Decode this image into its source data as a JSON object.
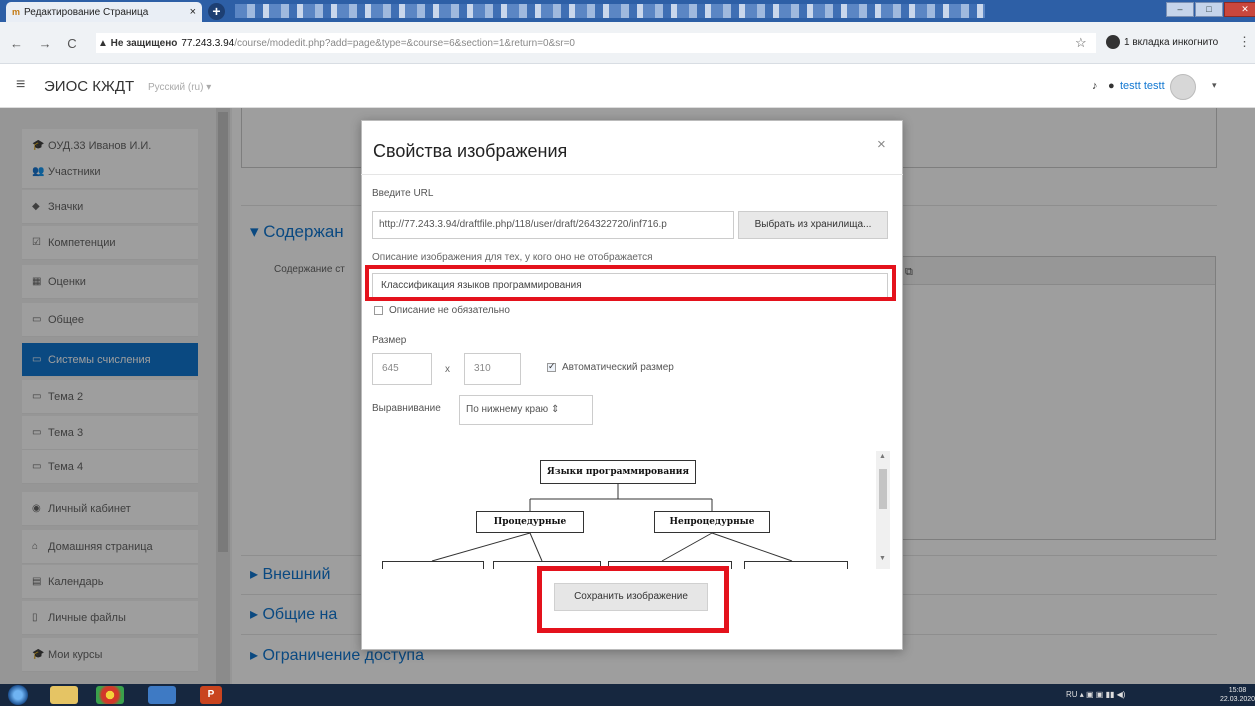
{
  "browser": {
    "tab_title": "Редактирование Страница",
    "tab_favicon": "moodle-icon",
    "nav_buttons": "← → C",
    "security_warning": "▲ Не защищено",
    "url_host": "77.243.3.94",
    "url_path": "/course/modedit.php?add=page&type=&course=6&section=1&return=0&sr=0",
    "incognito_label": "1 вкладка инкогнито"
  },
  "header": {
    "site_name": "ЭИОС КЖДТ",
    "language": "Русский (ru) ▾",
    "user_name": "testt testt"
  },
  "sidebar": {
    "items": [
      {
        "icon": "graduation-cap-icon",
        "glyph": "🎓",
        "label": "ОУД.33 Иванов И.И."
      },
      {
        "icon": "users-icon",
        "glyph": "👥",
        "label": "Участники"
      },
      {
        "icon": "shield-icon",
        "glyph": "◆",
        "label": "Значки"
      },
      {
        "icon": "checkbox-icon",
        "glyph": "☑",
        "label": "Компетенции"
      },
      {
        "icon": "table-icon",
        "glyph": "▦",
        "label": "Оценки"
      },
      {
        "icon": "folder-icon",
        "glyph": "▭",
        "label": "Общее"
      },
      {
        "icon": "folder-icon",
        "glyph": "▭",
        "label": "Системы счисления",
        "active": true
      },
      {
        "icon": "folder-icon",
        "glyph": "▭",
        "label": "Тема 2"
      },
      {
        "icon": "folder-icon",
        "glyph": "▭",
        "label": "Тема 3"
      },
      {
        "icon": "folder-icon",
        "glyph": "▭",
        "label": "Тема 4"
      },
      {
        "icon": "dashboard-icon",
        "glyph": "◉",
        "label": "Личный кабинет"
      },
      {
        "icon": "home-icon",
        "glyph": "⌂",
        "label": "Домашняя страница"
      },
      {
        "icon": "calendar-icon",
        "glyph": "▤",
        "label": "Календарь"
      },
      {
        "icon": "file-icon",
        "glyph": "▯",
        "label": "Личные файлы"
      },
      {
        "icon": "graduation-cap-icon",
        "glyph": "🎓",
        "label": "Мои курсы"
      }
    ]
  },
  "page": {
    "section_content": "▾ Содержан",
    "section_content_label": "Содержание ст",
    "section_appearance": "▸ Внешний",
    "section_common": "▸ Общие на",
    "section_access": "▸ Ограничение доступа"
  },
  "modal": {
    "title": "Свойства изображения",
    "close": "×",
    "url_label": "Введите URL",
    "url_value": "http://77.243.3.94/draftfile.php/118/user/draft/264322720/inf716.p",
    "browse_button": "Выбрать из хранилища...",
    "alt_label": "Описание изображения для тех, у кого оно не отображается",
    "alt_value": "Классификация языков программирования",
    "presentation_label": "Описание не обязательно",
    "presentation_checked": false,
    "size_label": "Размер",
    "width": "645",
    "size_sep": "x",
    "height": "310",
    "auto_size_label": "Автоматический размер",
    "auto_size_checked": true,
    "align_label": "Выравнивание",
    "align_value": "По нижнему краю ⇕",
    "save_button": "Сохранить изображение"
  },
  "preview_diagram": {
    "root": "Языки программирования",
    "left": "Процедурные",
    "right": "Непроцедурные"
  },
  "taskbar": {
    "lang": "RU",
    "time": "15:08",
    "date": "22.03.2020"
  },
  "colors": {
    "accent": "#1177d1",
    "highlight": "#e4121c"
  }
}
